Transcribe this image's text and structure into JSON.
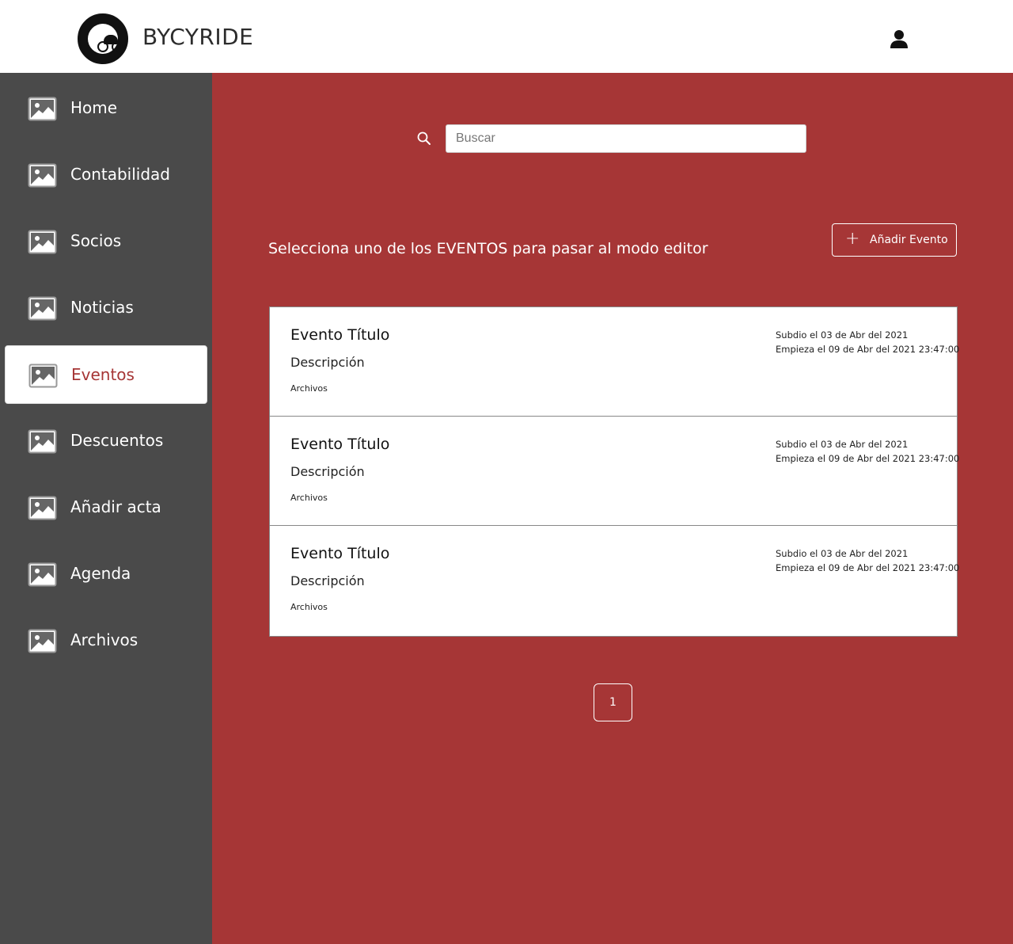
{
  "header": {
    "brand": "BYCYRIDE",
    "logo_icon": "club-logo-icon",
    "user_icon": "user-icon"
  },
  "sidebar": {
    "items": [
      {
        "label": "Home",
        "icon": "image-icon",
        "active": false
      },
      {
        "label": "Contabilidad",
        "icon": "image-icon",
        "active": false
      },
      {
        "label": "Socios",
        "icon": "image-icon",
        "active": false
      },
      {
        "label": "Noticias",
        "icon": "image-icon",
        "active": false
      },
      {
        "label": "Eventos",
        "icon": "image-icon",
        "active": true
      },
      {
        "label": "Descuentos",
        "icon": "image-icon",
        "active": false
      },
      {
        "label": "Añadir acta",
        "icon": "image-icon",
        "active": false
      },
      {
        "label": "Agenda",
        "icon": "image-icon",
        "active": false
      },
      {
        "label": "Archivos",
        "icon": "image-icon",
        "active": false
      }
    ]
  },
  "main": {
    "search": {
      "placeholder": "Buscar",
      "value": ""
    },
    "intro": "Selecciona uno de los EVENTOS para pasar al modo editor",
    "add_button": "Añadir Evento",
    "events": [
      {
        "title": "Evento Título",
        "description": "Descripción",
        "files": "Archivos",
        "uploaded": "Subdio el 03 de Abr del 2021",
        "starts": "Empieza el 09 de Abr del 2021 23:47:00"
      },
      {
        "title": "Evento Título",
        "description": "Descripción",
        "files": "Archivos",
        "uploaded": "Subdio el 03 de Abr del 2021",
        "starts": "Empieza el 09 de Abr del 2021 23:47:00"
      },
      {
        "title": "Evento Título",
        "description": "Descripción",
        "files": "Archivos",
        "uploaded": "Subdio el 03 de Abr del 2021",
        "starts": "Empieza el 09 de Abr del 2021 23:47:00"
      }
    ],
    "pagination": {
      "current_page": "1"
    }
  },
  "colors": {
    "accent": "#a63636",
    "sidebar_bg": "#4a4a4a",
    "header_bg": "#ffffff"
  }
}
